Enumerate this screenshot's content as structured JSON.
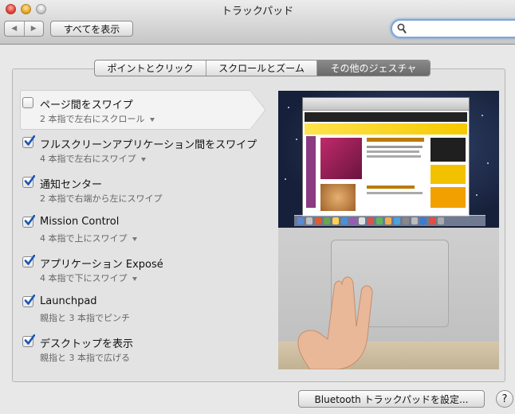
{
  "window": {
    "title": "トラックパッド"
  },
  "toolbar": {
    "back_glyph": "◀",
    "forward_glyph": "▶",
    "show_all_label": "すべてを表示",
    "search_value": ""
  },
  "tabs": [
    {
      "label": "ポイントとクリック",
      "active": false
    },
    {
      "label": "スクロールとズーム",
      "active": false
    },
    {
      "label": "その他のジェスチャ",
      "active": true
    }
  ],
  "options": [
    {
      "title": "ページ間をスワイプ",
      "subtitle": "2 本指で左右にスクロール",
      "checked": false,
      "has_menu": true,
      "selected": true
    },
    {
      "title": "フルスクリーンアプリケーション間をスワイプ",
      "subtitle": "4 本指で左右にスワイプ",
      "checked": true,
      "has_menu": true,
      "selected": false
    },
    {
      "title": "通知センター",
      "subtitle": "2 本指で右端から左にスワイプ",
      "checked": true,
      "has_menu": false,
      "selected": false
    },
    {
      "title": "Mission Control",
      "subtitle": "4 本指で上にスワイプ",
      "checked": true,
      "has_menu": true,
      "selected": false
    },
    {
      "title": "アプリケーション Exposé",
      "subtitle": "4 本指で下にスワイプ",
      "checked": true,
      "has_menu": true,
      "selected": false
    },
    {
      "title": "Launchpad",
      "subtitle": "親指と 3 本指でピンチ",
      "checked": true,
      "has_menu": false,
      "selected": false
    },
    {
      "title": "デスクトップを表示",
      "subtitle": "親指と 3 本指で広げる",
      "checked": true,
      "has_menu": false,
      "selected": false
    }
  ],
  "footer": {
    "bluetooth_button_label": "Bluetooth トラックパッドを設定...",
    "help_label": "?"
  },
  "colors": {
    "accent_check": "#1a55b8",
    "active_tab": "#6f6f6f"
  }
}
